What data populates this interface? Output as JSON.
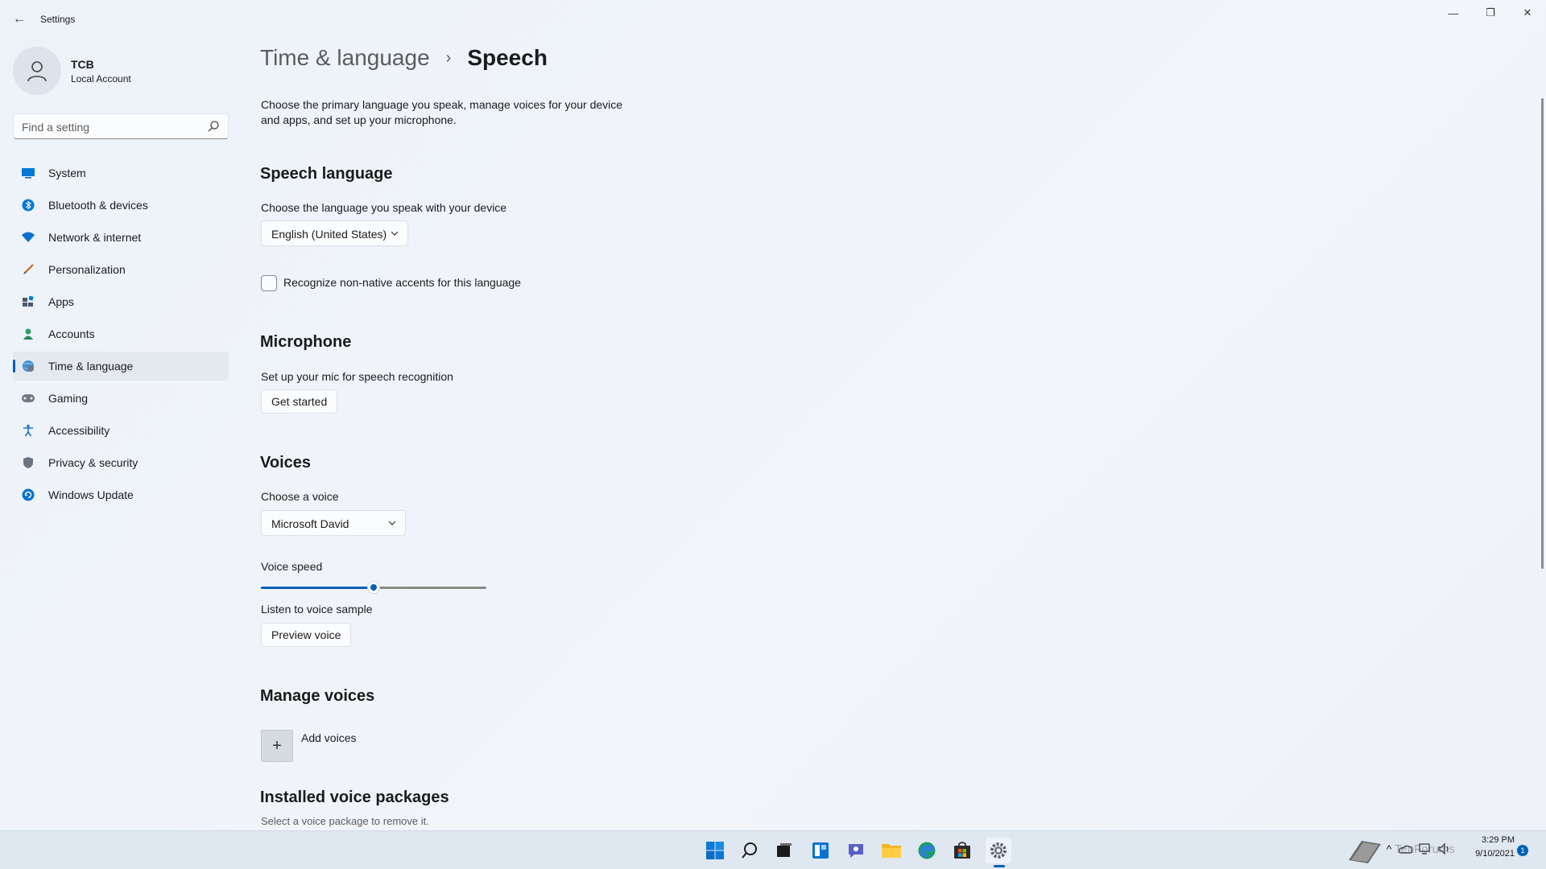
{
  "window": {
    "app_title": "Settings",
    "back_symbol": "←",
    "minimize_symbol": "—",
    "maximize_symbol": "❐",
    "close_symbol": "✕"
  },
  "profile": {
    "name": "TCB",
    "account_type": "Local Account"
  },
  "search": {
    "placeholder": "Find a setting"
  },
  "sidebar": {
    "items": [
      {
        "label": "System",
        "icon": "system-icon",
        "active": false
      },
      {
        "label": "Bluetooth & devices",
        "icon": "bluetooth-icon",
        "active": false
      },
      {
        "label": "Network & internet",
        "icon": "wifi-icon",
        "active": false
      },
      {
        "label": "Personalization",
        "icon": "brush-icon",
        "active": false
      },
      {
        "label": "Apps",
        "icon": "apps-icon",
        "active": false
      },
      {
        "label": "Accounts",
        "icon": "person-icon",
        "active": false
      },
      {
        "label": "Time & language",
        "icon": "globe-clock-icon",
        "active": true
      },
      {
        "label": "Gaming",
        "icon": "gamepad-icon",
        "active": false
      },
      {
        "label": "Accessibility",
        "icon": "accessibility-icon",
        "active": false
      },
      {
        "label": "Privacy & security",
        "icon": "shield-icon",
        "active": false
      },
      {
        "label": "Windows Update",
        "icon": "update-icon",
        "active": false
      }
    ]
  },
  "breadcrumb": {
    "parent": "Time & language",
    "separator": "›",
    "current": "Speech"
  },
  "description": "Choose the primary language you speak, manage voices for your device and apps, and set up your microphone.",
  "speech_language": {
    "title": "Speech language",
    "prompt": "Choose the language you speak with your device",
    "selected": "English (United States)",
    "checkbox_label": "Recognize non-native accents for this language",
    "checkbox_checked": false
  },
  "microphone": {
    "title": "Microphone",
    "prompt": "Set up your mic for speech recognition",
    "button": "Get started"
  },
  "voices": {
    "title": "Voices",
    "prompt": "Choose a voice",
    "selected": "Microsoft David",
    "speed_label": "Voice speed",
    "speed_fraction": 0.5,
    "sample_label": "Listen to voice sample",
    "preview_button": "Preview voice"
  },
  "manage_voices": {
    "title": "Manage voices",
    "add_symbol": "+",
    "add_label": "Add voices"
  },
  "installed": {
    "title": "Installed voice packages",
    "subtitle": "Select a voice package to remove it."
  },
  "taskbar": {
    "time": "3:29 PM",
    "date": "9/10/2021",
    "notification_count": "1",
    "watermark": "TenForums"
  },
  "colors": {
    "accent": "#005fb8",
    "background": "#eef3f9"
  }
}
